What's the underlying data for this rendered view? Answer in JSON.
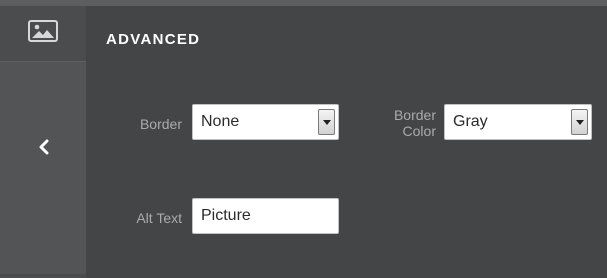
{
  "sidebar": {
    "image_icon": "image-icon",
    "back_icon": "chevron-left-icon"
  },
  "panel": {
    "title": "ADVANCED",
    "border": {
      "label": "Border",
      "selected": "None"
    },
    "border_color": {
      "label_line1": "Border",
      "label_line2": "Color",
      "selected": "Gray"
    },
    "alt_text": {
      "label": "Alt Text",
      "value": "Picture"
    }
  },
  "colors": {
    "background": "#434547",
    "rail": "#525456",
    "title": "#ffffff",
    "label": "#a9abad"
  }
}
